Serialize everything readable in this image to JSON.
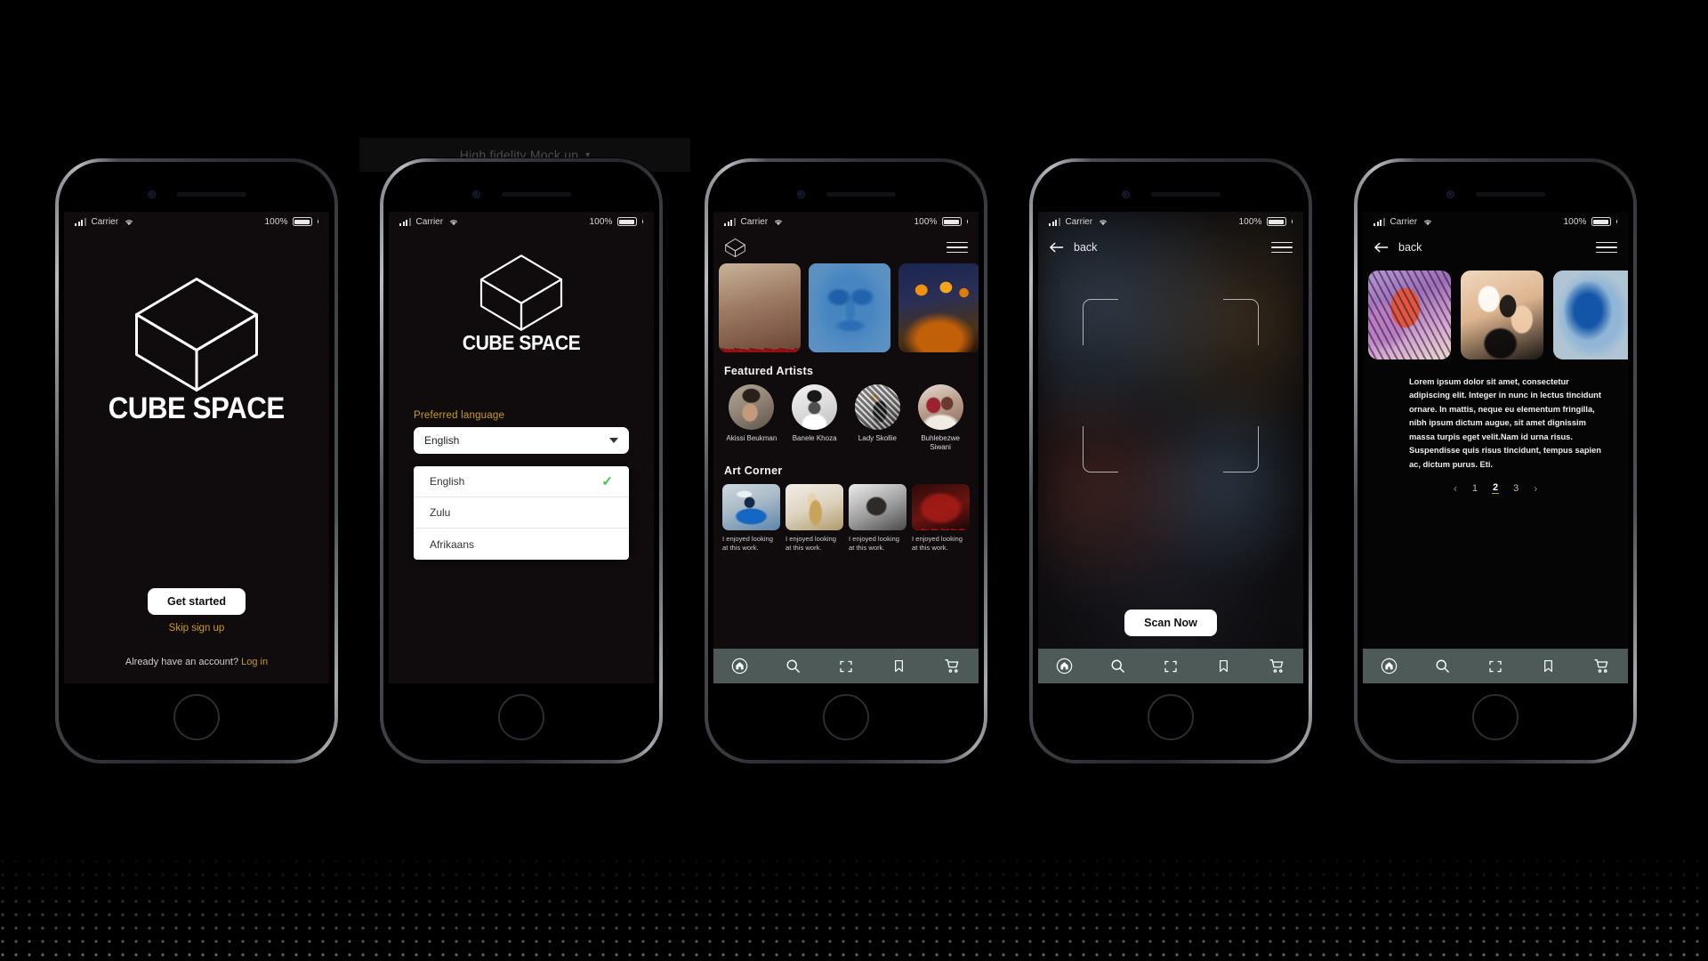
{
  "mockup": {
    "caption": "High fidelity Mock up",
    "chevron": "chevron-down"
  },
  "colors": {
    "gold": "#c89a1e",
    "screen_bg": "#100c0e",
    "navbar": "#4e5a58",
    "check_green": "#3ec24a"
  },
  "status_bar": {
    "carrier": "Carrier",
    "battery_percent": "100%",
    "signal_icon": "signal-bars-icon",
    "wifi_icon": "wifi-icon",
    "battery_icon": "battery-icon"
  },
  "brand": {
    "name": "CUBE SPACE",
    "logo_icon": "cube-logo-icon"
  },
  "screen1": {
    "cta_label": "Get started",
    "skip_label": "Skip sign up",
    "account_prompt": "Already have an account?",
    "login_label": "Log in"
  },
  "screen2": {
    "language_label": "Preferred  language",
    "selected_value": "English",
    "options": [
      {
        "label": "English",
        "selected": true
      },
      {
        "label": "Zulu",
        "selected": false
      },
      {
        "label": "Afrikaans",
        "selected": false
      }
    ]
  },
  "screen3": {
    "header_logo_icon": "cube-icon",
    "menu_icon": "hamburger-menu-icon",
    "hero": [
      {
        "name": "red-drip-installation"
      },
      {
        "name": "blue-watercolor-face"
      },
      {
        "name": "orange-abstract"
      }
    ],
    "featured_title": "Featured Artists",
    "artists": [
      {
        "name": "Akissi Beukman"
      },
      {
        "name": "Banele Khoza"
      },
      {
        "name": "Lady Skollie"
      },
      {
        "name": "Buhlebezwe Siwani"
      }
    ],
    "corner_title": "Art  Corner",
    "corner_items": [
      {
        "caption": "I enjoyed looking at this work."
      },
      {
        "caption": "I enjoyed looking at this work."
      },
      {
        "caption": "I enjoyed looking at this work."
      },
      {
        "caption": "I enjoyed looking at this work."
      }
    ]
  },
  "screen4": {
    "back_label": "back",
    "back_icon": "arrow-left-icon",
    "menu_icon": "hamburger-menu-icon",
    "scan_frame_icon": "scan-brackets-icon",
    "scan_button": "Scan Now"
  },
  "screen5": {
    "back_label": "back",
    "back_icon": "arrow-left-icon",
    "menu_icon": "hamburger-menu-icon",
    "gallery": [
      {
        "name": "pink-purple-portrait"
      },
      {
        "name": "ink-black-white-portrait"
      },
      {
        "name": "blue-wash-face"
      }
    ],
    "body_text": "Lorem ipsum dolor sit amet, consectetur adipiscing elit. Integer in nunc in lectus tincidunt ornare. In mattis, neque eu elementum fringilla, nibh ipsum dictum augue, sit amet dignissim massa turpis eget velit.Nam id urna risus. Suspendisse quis risus tincidunt, tempus sapien ac, dictum purus. Eti.",
    "pagination": {
      "prev": "‹",
      "next": "›",
      "pages": [
        "1",
        "2",
        "3"
      ],
      "active": "2"
    }
  },
  "bottom_nav": {
    "items": [
      {
        "icon": "home-icon",
        "label": "Home"
      },
      {
        "icon": "search-icon",
        "label": "Search"
      },
      {
        "icon": "scan-icon",
        "label": "Scan"
      },
      {
        "icon": "bookmark-icon",
        "label": "Saved"
      },
      {
        "icon": "cart-icon",
        "label": "Cart"
      }
    ]
  }
}
